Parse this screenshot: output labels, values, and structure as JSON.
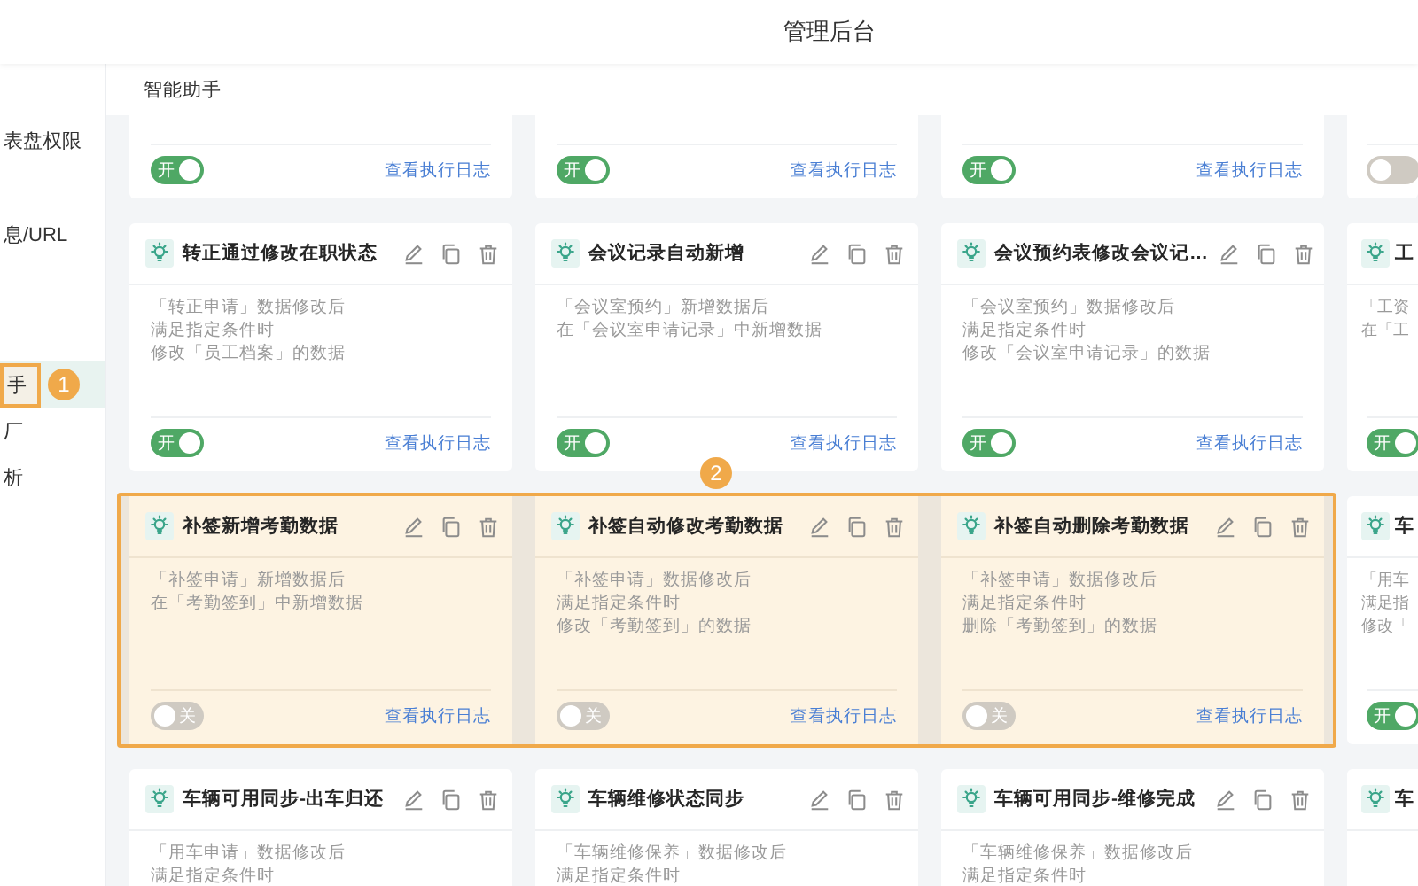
{
  "header": {
    "title": "管理后台"
  },
  "sidebar": {
    "items": [
      {
        "label": "表盘权限",
        "selected": false
      },
      {
        "label": "息/URL",
        "selected": false
      },
      {
        "label": "手",
        "selected": true,
        "annotation": "1"
      },
      {
        "label": "厂",
        "selected": false
      },
      {
        "label": "析",
        "selected": false
      }
    ]
  },
  "main": {
    "breadcrumb": "智能助手",
    "rows": [
      {
        "kind": "footer_only",
        "cards": [
          {
            "kind": "full",
            "enabled": true,
            "toggle_label": "开",
            "link": "查看执行日志",
            "highlighted": false
          },
          {
            "kind": "full",
            "enabled": true,
            "toggle_label": "开",
            "link": "查看执行日志",
            "highlighted": false
          },
          {
            "kind": "full",
            "enabled": true,
            "toggle_label": "开",
            "link": "查看执行日志",
            "highlighted": false
          },
          {
            "kind": "cut",
            "enabled": false,
            "highlighted": false
          }
        ]
      },
      {
        "kind": "full",
        "cards": [
          {
            "kind": "full",
            "title": "转正通过修改在职状态",
            "description": [
              "「转正申请」数据修改后",
              "满足指定条件时",
              "修改「员工档案」的数据"
            ],
            "enabled": true,
            "toggle_label": "开",
            "link": "查看执行日志",
            "highlighted": false
          },
          {
            "kind": "full",
            "title": "会议记录自动新增",
            "description": [
              "「会议室预约」新增数据后",
              "在「会议室申请记录」中新增数据"
            ],
            "enabled": true,
            "toggle_label": "开",
            "link": "查看执行日志",
            "highlighted": false
          },
          {
            "kind": "full",
            "title": "会议预约表修改会议记…",
            "description": [
              "「会议室预约」数据修改后",
              "满足指定条件时",
              "修改「会议室申请记录」的数据"
            ],
            "enabled": true,
            "toggle_label": "开",
            "link": "查看执行日志",
            "highlighted": false
          },
          {
            "kind": "cut",
            "title": "工",
            "description": [
              "「工资",
              "在「工"
            ],
            "enabled": true,
            "toggle_label": "开",
            "highlighted": false
          }
        ]
      },
      {
        "kind": "full",
        "annotation": "2",
        "cards": [
          {
            "kind": "full",
            "title": "补签新增考勤数据",
            "description": [
              "「补签申请」新增数据后",
              "在「考勤签到」中新增数据"
            ],
            "enabled": false,
            "toggle_label": "关",
            "link": "查看执行日志",
            "highlighted": true
          },
          {
            "kind": "full",
            "title": "补签自动修改考勤数据",
            "description": [
              "「补签申请」数据修改后",
              "满足指定条件时",
              "修改「考勤签到」的数据"
            ],
            "enabled": false,
            "toggle_label": "关",
            "link": "查看执行日志",
            "highlighted": true
          },
          {
            "kind": "full",
            "title": "补签自动删除考勤数据",
            "description": [
              "「补签申请」数据修改后",
              "满足指定条件时",
              "删除「考勤签到」的数据"
            ],
            "enabled": false,
            "toggle_label": "关",
            "link": "查看执行日志",
            "highlighted": true
          },
          {
            "kind": "cut",
            "title": "车",
            "description": [
              "「用车",
              "满足指",
              "修改「"
            ],
            "enabled": true,
            "toggle_label": "开",
            "highlighted": false
          }
        ]
      },
      {
        "kind": "header_only",
        "cards": [
          {
            "kind": "full",
            "title": "车辆可用同步-出车归还",
            "description": [
              "「用车申请」数据修改后",
              "满足指定条件时"
            ],
            "highlighted": false
          },
          {
            "kind": "full",
            "title": "车辆维修状态同步",
            "description": [
              "「车辆维修保养」数据修改后",
              "满足指定条件时"
            ],
            "highlighted": false
          },
          {
            "kind": "full",
            "title": "车辆可用同步-维修完成",
            "description": [
              "「车辆维修保养」数据修改后",
              "满足指定条件时"
            ],
            "highlighted": false
          },
          {
            "kind": "cut",
            "title": "车",
            "highlighted": false
          }
        ]
      }
    ]
  }
}
